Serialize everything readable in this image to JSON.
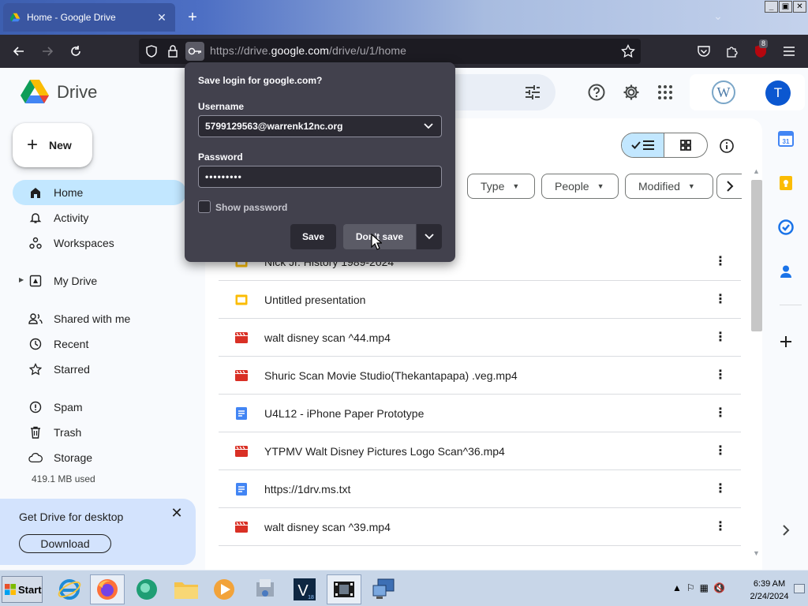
{
  "browser": {
    "tab_title": "Home - Google Drive",
    "url_prefix": "https://drive.",
    "url_domain": "google.com",
    "url_suffix": "/drive/u/1/home",
    "extension_badge": "8"
  },
  "drive": {
    "app_name": "Drive",
    "new_label": "New",
    "nav": [
      {
        "label": "Home",
        "icon": "home-icon"
      },
      {
        "label": "Activity",
        "icon": "bell-icon"
      },
      {
        "label": "Workspaces",
        "icon": "workspaces-icon"
      },
      {
        "label": "My Drive",
        "icon": "my-drive-icon"
      },
      {
        "label": "Shared with me",
        "icon": "people-icon"
      },
      {
        "label": "Recent",
        "icon": "clock-icon"
      },
      {
        "label": "Starred",
        "icon": "star-icon"
      },
      {
        "label": "Spam",
        "icon": "spam-icon"
      },
      {
        "label": "Trash",
        "icon": "trash-icon"
      },
      {
        "label": "Storage",
        "icon": "cloud-icon"
      }
    ],
    "storage_used": "419.1 MB used",
    "promo": {
      "title": "Get Drive for desktop",
      "button": "Download"
    },
    "avatar_letter": "T",
    "filters": [
      "Type",
      "People",
      "Modified"
    ],
    "files": [
      {
        "name": "Nick Jr. History 1989-2024",
        "type": "slides"
      },
      {
        "name": "Untitled presentation",
        "type": "slides"
      },
      {
        "name": "walt disney scan ^44.mp4",
        "type": "video"
      },
      {
        "name": "Shuric Scan Movie Studio(Thekantapapa) .veg.mp4",
        "type": "video"
      },
      {
        "name": "U4L12 - iPhone Paper Prototype",
        "type": "doc"
      },
      {
        "name": "YTPMV Walt Disney Pictures Logo Scan^36.mp4",
        "type": "video"
      },
      {
        "name": "https://1drv.ms.txt",
        "type": "doc"
      },
      {
        "name": "walt disney scan ^39.mp4",
        "type": "video"
      }
    ]
  },
  "save_login": {
    "title": "Save login for google.com?",
    "username_label": "Username",
    "username_value": "5799129563@warrenk12nc.org",
    "password_label": "Password",
    "password_value": "•••••••••",
    "show_password": "Show password",
    "save_button": "Save",
    "dont_save_button": "Don't save"
  },
  "taskbar": {
    "start": "Start",
    "time": "6:39 AM",
    "date": "2/24/2024"
  },
  "colors": {
    "accent": "#0b57d0",
    "active_nav": "#c2e7ff",
    "popup_bg": "#42414d",
    "video_red": "#d93025",
    "slides_yellow": "#fbbc04",
    "doc_blue": "#4285f4"
  }
}
